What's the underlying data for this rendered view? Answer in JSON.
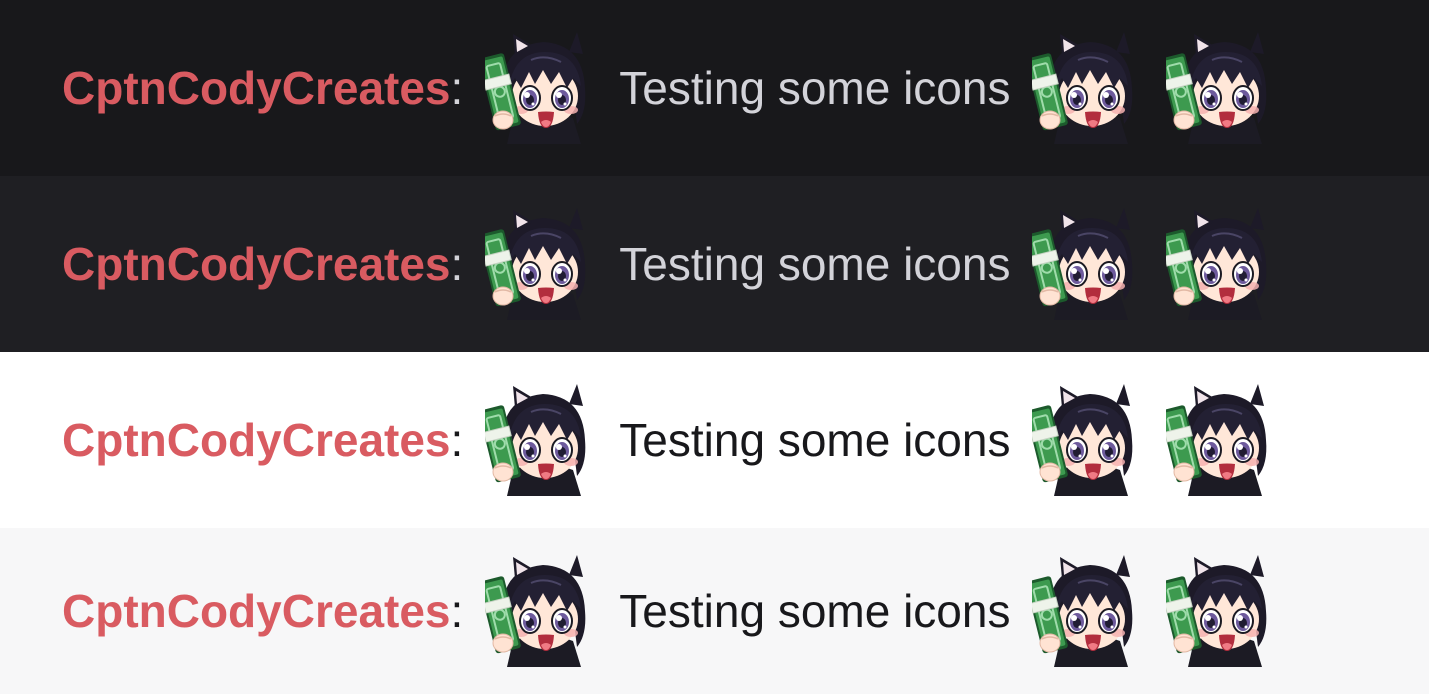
{
  "themes": [
    {
      "background": "#18181b",
      "text_color": "#d3d3d9"
    },
    {
      "background": "#1f1f23",
      "text_color": "#d3d3d9"
    },
    {
      "background": "#ffffff",
      "text_color": "#18181b"
    },
    {
      "background": "#f7f7f8",
      "text_color": "#18181b"
    }
  ],
  "message": {
    "username": "CptnCodyCreates",
    "separator": ":",
    "text": "Testing some icons",
    "username_color": "#d95b61",
    "emote_icon": "anime-character-holding-cash-emote"
  }
}
